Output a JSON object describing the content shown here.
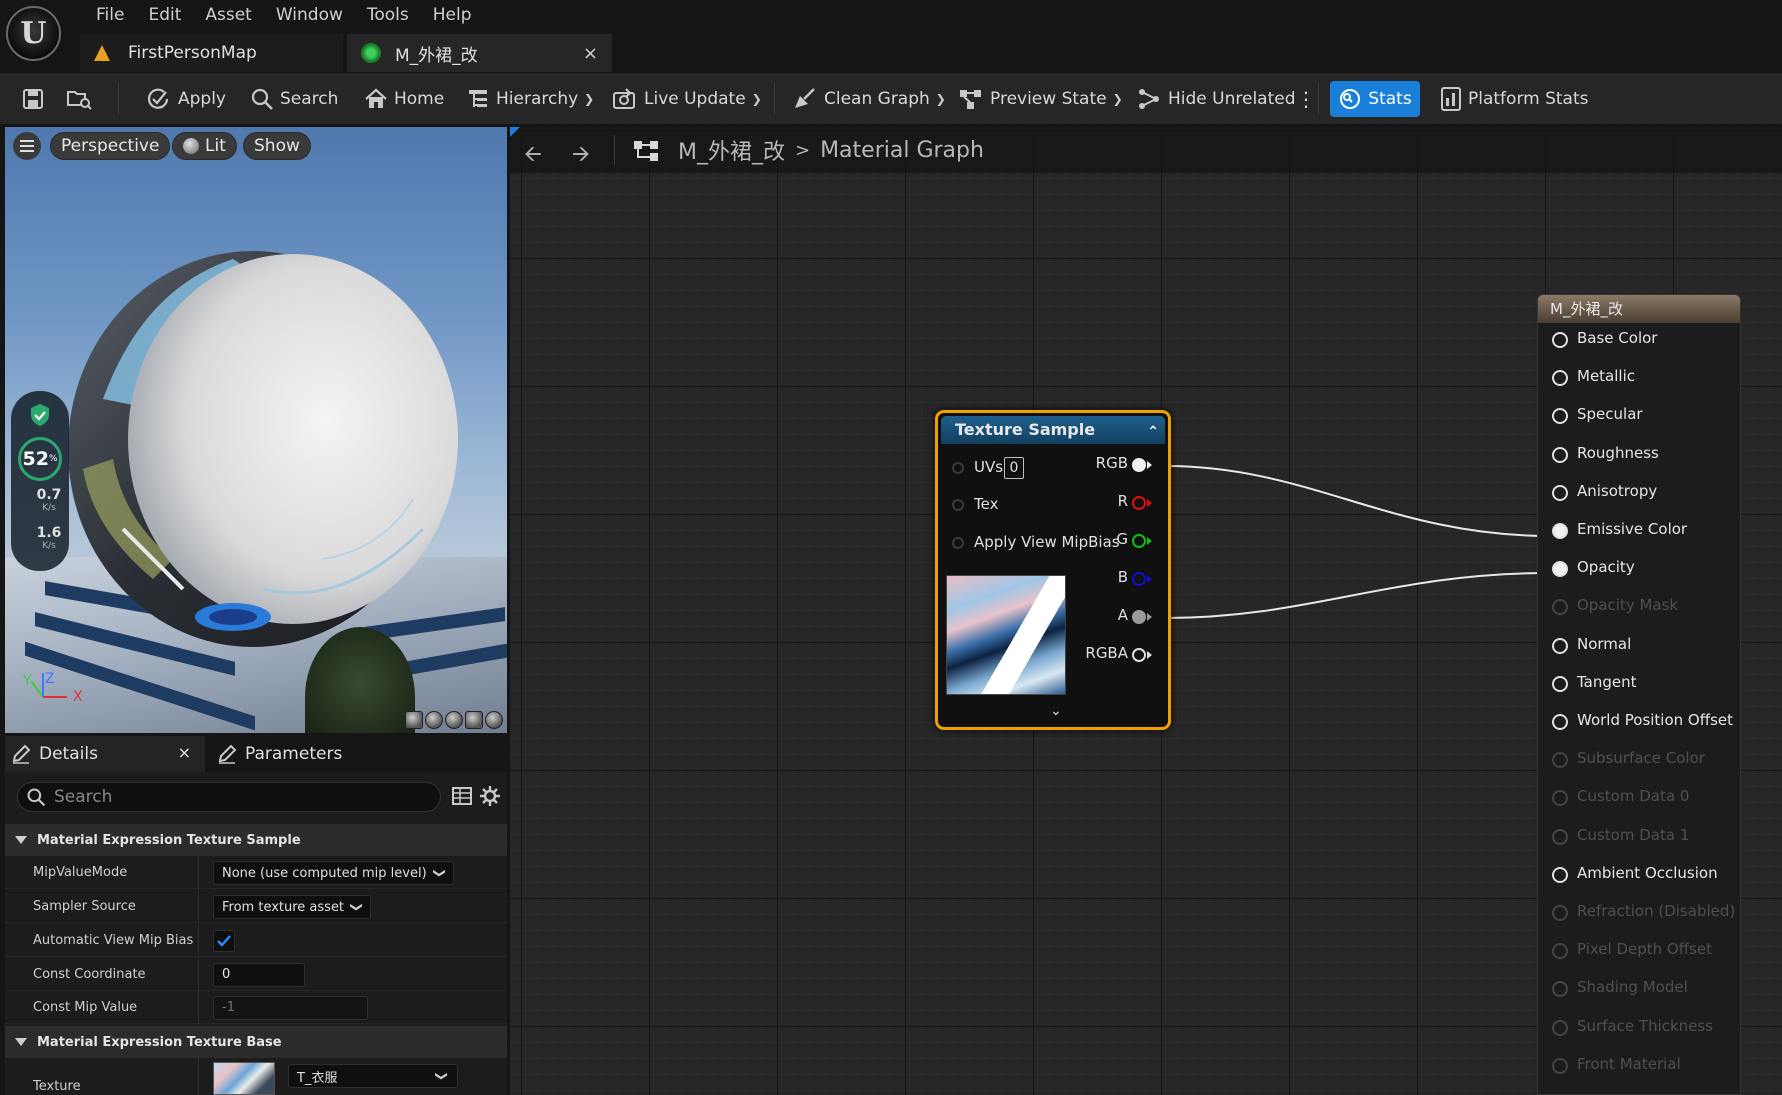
{
  "menu": [
    "File",
    "Edit",
    "Asset",
    "Window",
    "Tools",
    "Help"
  ],
  "tabs": [
    {
      "label": "FirstPersonMap"
    },
    {
      "label": "M_外裙_改",
      "close": "×"
    }
  ],
  "toolbar": {
    "apply": "Apply",
    "search": "Search",
    "home": "Home",
    "hierarchy": "Hierarchy",
    "live_update": "Live Update",
    "clean_graph": "Clean Graph",
    "preview_state": "Preview State",
    "hide_unrelated": "Hide Unrelated",
    "stats": "Stats",
    "platform_stats": "Platform Stats",
    "accent_color": "#1a7fd8"
  },
  "viewport": {
    "perspective": "Perspective",
    "lit": "Lit",
    "show": "Show",
    "perf_percent": "52",
    "perf_unit": "%",
    "upload_rate": "0.7",
    "download_rate": "1.6",
    "rate_unit": "K/s",
    "axis_y": "Y",
    "axis_z": "Z",
    "axis_x": "X"
  },
  "details": {
    "tab_details": "Details",
    "tab_close": "×",
    "tab_parameters": "Parameters",
    "search_placeholder": "Search",
    "section_texture_sample": "Material Expression Texture Sample",
    "section_texture_base": "Material Expression Texture Base",
    "rows": {
      "mip_value_mode": {
        "label": "MipValueMode",
        "value": "None (use computed mip level)"
      },
      "sampler_source": {
        "label": "Sampler Source",
        "value": "From texture asset"
      },
      "auto_view_mip_bias": {
        "label": "Automatic View Mip Bias",
        "checked": true
      },
      "const_coordinate": {
        "label": "Const Coordinate",
        "value": "0"
      },
      "const_mip_value": {
        "label": "Const Mip Value",
        "value": "-1"
      },
      "texture": {
        "label": "Texture",
        "value": "T_衣服"
      }
    }
  },
  "graph": {
    "breadcrumb_asset": "M_外裙_改",
    "breadcrumb_sep": ">",
    "breadcrumb_graph": "Material Graph",
    "texture_node": {
      "title": "Texture Sample",
      "inputs": [
        "UVs",
        "Tex",
        "Apply View MipBias"
      ],
      "uvs_value": "0",
      "outputs": [
        {
          "label": "RGB",
          "color": "#f0f0f0"
        },
        {
          "label": "R",
          "color": "#e01010"
        },
        {
          "label": "G",
          "color": "#10c010"
        },
        {
          "label": "B",
          "color": "#1010d0"
        },
        {
          "label": "A",
          "color": "#9a9a9a"
        },
        {
          "label": "RGBA",
          "color": "#e0e0e0"
        }
      ]
    },
    "material_node": {
      "title": "M_外裙_改",
      "pins": [
        {
          "label": "Base Color",
          "state": "enabled"
        },
        {
          "label": "Metallic",
          "state": "enabled"
        },
        {
          "label": "Specular",
          "state": "enabled"
        },
        {
          "label": "Roughness",
          "state": "enabled"
        },
        {
          "label": "Anisotropy",
          "state": "enabled"
        },
        {
          "label": "Emissive Color",
          "state": "connected"
        },
        {
          "label": "Opacity",
          "state": "connected"
        },
        {
          "label": "Opacity Mask",
          "state": "disabled"
        },
        {
          "label": "Normal",
          "state": "enabled"
        },
        {
          "label": "Tangent",
          "state": "enabled"
        },
        {
          "label": "World Position Offset",
          "state": "enabled"
        },
        {
          "label": "Subsurface Color",
          "state": "disabled"
        },
        {
          "label": "Custom Data 0",
          "state": "disabled"
        },
        {
          "label": "Custom Data 1",
          "state": "disabled"
        },
        {
          "label": "Ambient Occlusion",
          "state": "enabled"
        },
        {
          "label": "Refraction (Disabled)",
          "state": "disabled"
        },
        {
          "label": "Pixel Depth Offset",
          "state": "disabled"
        },
        {
          "label": "Shading Model",
          "state": "disabled"
        },
        {
          "label": "Surface Thickness",
          "state": "disabled"
        },
        {
          "label": "Front Material",
          "state": "disabled"
        }
      ]
    }
  }
}
